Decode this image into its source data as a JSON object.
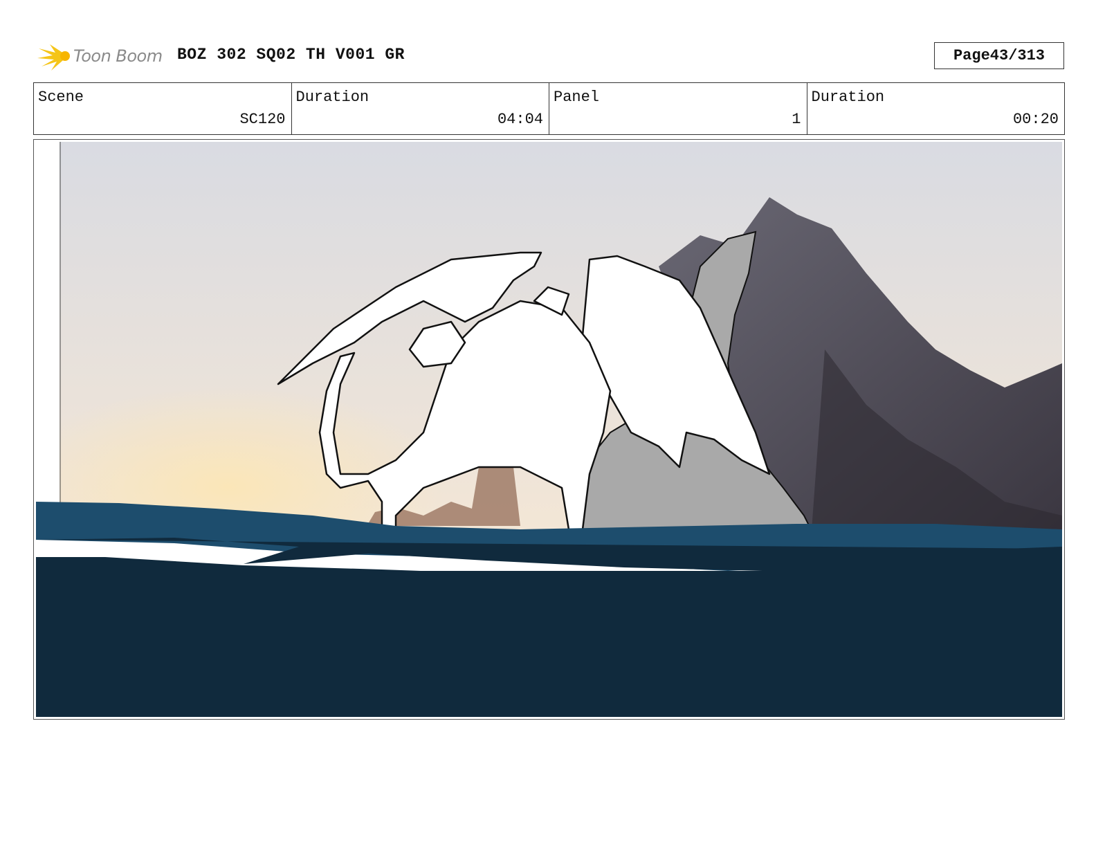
{
  "header": {
    "logo_text": "Toon Boom",
    "title": "BOZ 302 SQ02 TH V001 GR",
    "page_label": "Page",
    "page_value": "43/313"
  },
  "info": {
    "scene_label": "Scene",
    "scene_value": "SC120",
    "scene_duration_label": "Duration",
    "scene_duration_value": "04:04",
    "panel_label": "Panel",
    "panel_value": "1",
    "panel_duration_label": "Duration",
    "panel_duration_value": "00:20"
  },
  "panel": {
    "sky_top": "#d9dbe2",
    "sky_horizon": "#f3e6d6",
    "sun_glow": "#fbe6b8",
    "mountain_light": "#6a6874",
    "mountain_dark": "#3a3640",
    "cliff_color": "#9a7460",
    "water_light": "#1d4d6d",
    "water_dark": "#102a3d",
    "rocks_gray": "#a9a9a9",
    "dragon_fill": "#ffffff",
    "line_color": "#111111"
  }
}
